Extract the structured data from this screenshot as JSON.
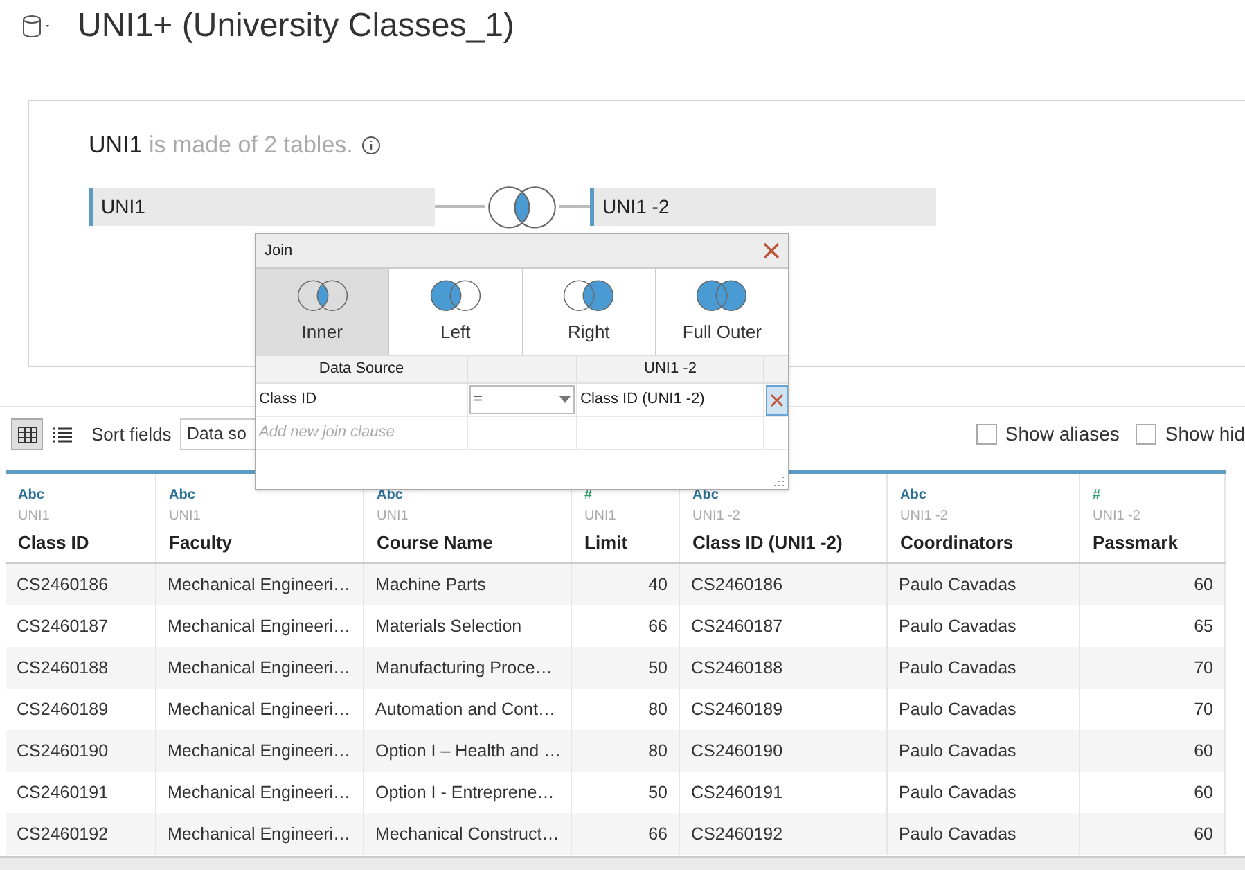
{
  "header": {
    "title": "UNI1+ (University Classes_1)"
  },
  "canvas": {
    "summary": "**UNI1** is made of 2 tables.",
    "tables": [
      {
        "name": "UNI1"
      },
      {
        "name": "UNI1 -2"
      }
    ]
  },
  "join_dialog": {
    "title": "Join",
    "types": [
      {
        "label": "Inner",
        "kind": "inner",
        "selected": true
      },
      {
        "label": "Left",
        "kind": "left",
        "selected": false
      },
      {
        "label": "Right",
        "kind": "right",
        "selected": false
      },
      {
        "label": "Full Outer",
        "kind": "full",
        "selected": false
      }
    ],
    "clause_headers": {
      "left": "Data Source",
      "right": "UNI1 -2"
    },
    "clauses": [
      {
        "left": "Class ID",
        "operator": "=",
        "right": "Class ID (UNI1 -2)"
      }
    ],
    "new_clause": {
      "placeholder": "Add new join clause"
    }
  },
  "toolbar": {
    "views": [
      {
        "kind": "grid",
        "selected": true
      },
      {
        "kind": "list",
        "selected": false
      }
    ],
    "sort_label": "Sort fields",
    "sort_value": "Data so",
    "checkboxes": [
      {
        "label": "Show aliases",
        "checked": false
      },
      {
        "label": "Show hid",
        "checked": false
      }
    ]
  },
  "table": {
    "columns": [
      {
        "type": "Abc",
        "kind": "string",
        "source": "UNI1",
        "name": "Class ID"
      },
      {
        "type": "Abc",
        "kind": "string",
        "source": "UNI1",
        "name": "Faculty"
      },
      {
        "type": "Abc",
        "kind": "string",
        "source": "UNI1",
        "name": "Course Name"
      },
      {
        "type": "#",
        "kind": "number",
        "source": "UNI1",
        "name": "Limit"
      },
      {
        "type": "Abc",
        "kind": "string",
        "source": "UNI1 -2",
        "name": "Class ID (UNI1 -2)"
      },
      {
        "type": "Abc",
        "kind": "string",
        "source": "UNI1 -2",
        "name": "Coordinators"
      },
      {
        "type": "#",
        "kind": "number",
        "source": "UNI1 -2",
        "name": "Passmark"
      }
    ],
    "rows": [
      [
        "CS2460186",
        "Mechanical Engineeri…",
        "Machine Parts",
        "40",
        "CS2460186",
        "Paulo Cavadas",
        "60"
      ],
      [
        "CS2460187",
        "Mechanical Engineeri…",
        "Materials Selection",
        "66",
        "CS2460187",
        "Paulo Cavadas",
        "65"
      ],
      [
        "CS2460188",
        "Mechanical Engineeri…",
        "Manufacturing Proce…",
        "50",
        "CS2460188",
        "Paulo Cavadas",
        "70"
      ],
      [
        "CS2460189",
        "Mechanical Engineeri…",
        "Automation and Cont…",
        "80",
        "CS2460189",
        "Paulo Cavadas",
        "70"
      ],
      [
        "CS2460190",
        "Mechanical Engineeri…",
        "Option I – Health and …",
        "80",
        "CS2460190",
        "Paulo Cavadas",
        "60"
      ],
      [
        "CS2460191",
        "Mechanical Engineeri…",
        "Option I - Entreprene…",
        "50",
        "CS2460191",
        "Paulo Cavadas",
        "60"
      ],
      [
        "CS2460192",
        "Mechanical Engineeri…",
        "Mechanical Construct…",
        "66",
        "CS2460192",
        "Paulo Cavadas",
        "60"
      ]
    ]
  }
}
